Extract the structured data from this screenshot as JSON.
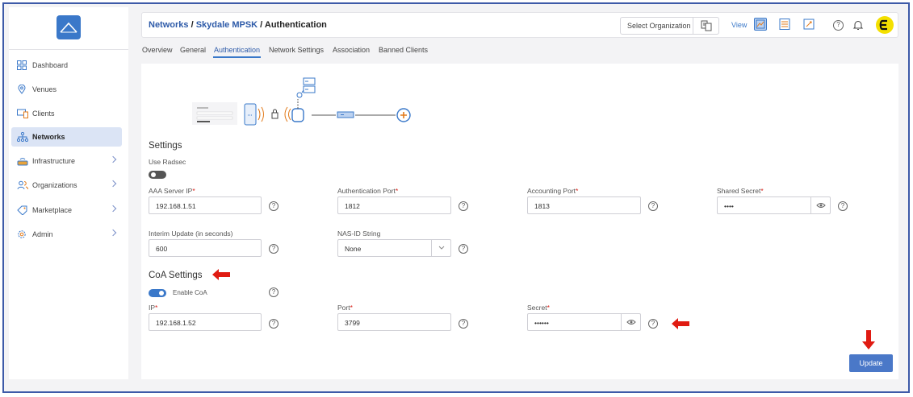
{
  "sidebar": {
    "items": [
      {
        "label": "Dashboard",
        "icon": "grid-icon"
      },
      {
        "label": "Venues",
        "icon": "map-pin-icon"
      },
      {
        "label": "Clients",
        "icon": "devices-icon"
      },
      {
        "label": "Networks",
        "icon": "network-icon",
        "active": true
      },
      {
        "label": "Infrastructure",
        "icon": "router-icon",
        "expandable": true
      },
      {
        "label": "Organizations",
        "icon": "users-icon",
        "expandable": true
      },
      {
        "label": "Marketplace",
        "icon": "tag-icon",
        "expandable": true
      },
      {
        "label": "Admin",
        "icon": "gear-icon",
        "expandable": true
      }
    ]
  },
  "header": {
    "breadcrumb_networks": "Networks",
    "breadcrumb_sep1": " / ",
    "breadcrumb_network": "Skydale MPSK",
    "breadcrumb_sep2": " / ",
    "breadcrumb_page": "Authentication",
    "select_org": "Select Organization",
    "view_label": "View"
  },
  "tabs": [
    "Overview",
    "General",
    "Authentication",
    "Network Settings",
    "Association",
    "Banned Clients"
  ],
  "settings": {
    "title": "Settings",
    "use_radsec": "Use Radsec",
    "aaa_ip_label": "AAA Server IP",
    "aaa_ip": "192.168.1.51",
    "auth_port_label": "Authentication Port",
    "auth_port": "1812",
    "acct_port_label": "Accounting Port",
    "acct_port": "1813",
    "shared_secret_label": "Shared Secret",
    "shared_secret": "••••",
    "interim_label": "Interim Update (in seconds)",
    "interim": "600",
    "nas_label": "NAS-ID String",
    "nas": "None"
  },
  "coa": {
    "title": "CoA Settings",
    "enable_label": "Enable CoA",
    "ip_label": "IP",
    "ip": "192.168.1.52",
    "port_label": "Port",
    "port": "3799",
    "secret_label": "Secret",
    "secret": "••••••"
  },
  "actions": {
    "update": "Update"
  },
  "colors": {
    "accent": "#3a78c9",
    "required": "#d9231b",
    "annotation": "#e01b12",
    "toggle_on": "#3a78c9",
    "toggle_off": "#555555"
  }
}
